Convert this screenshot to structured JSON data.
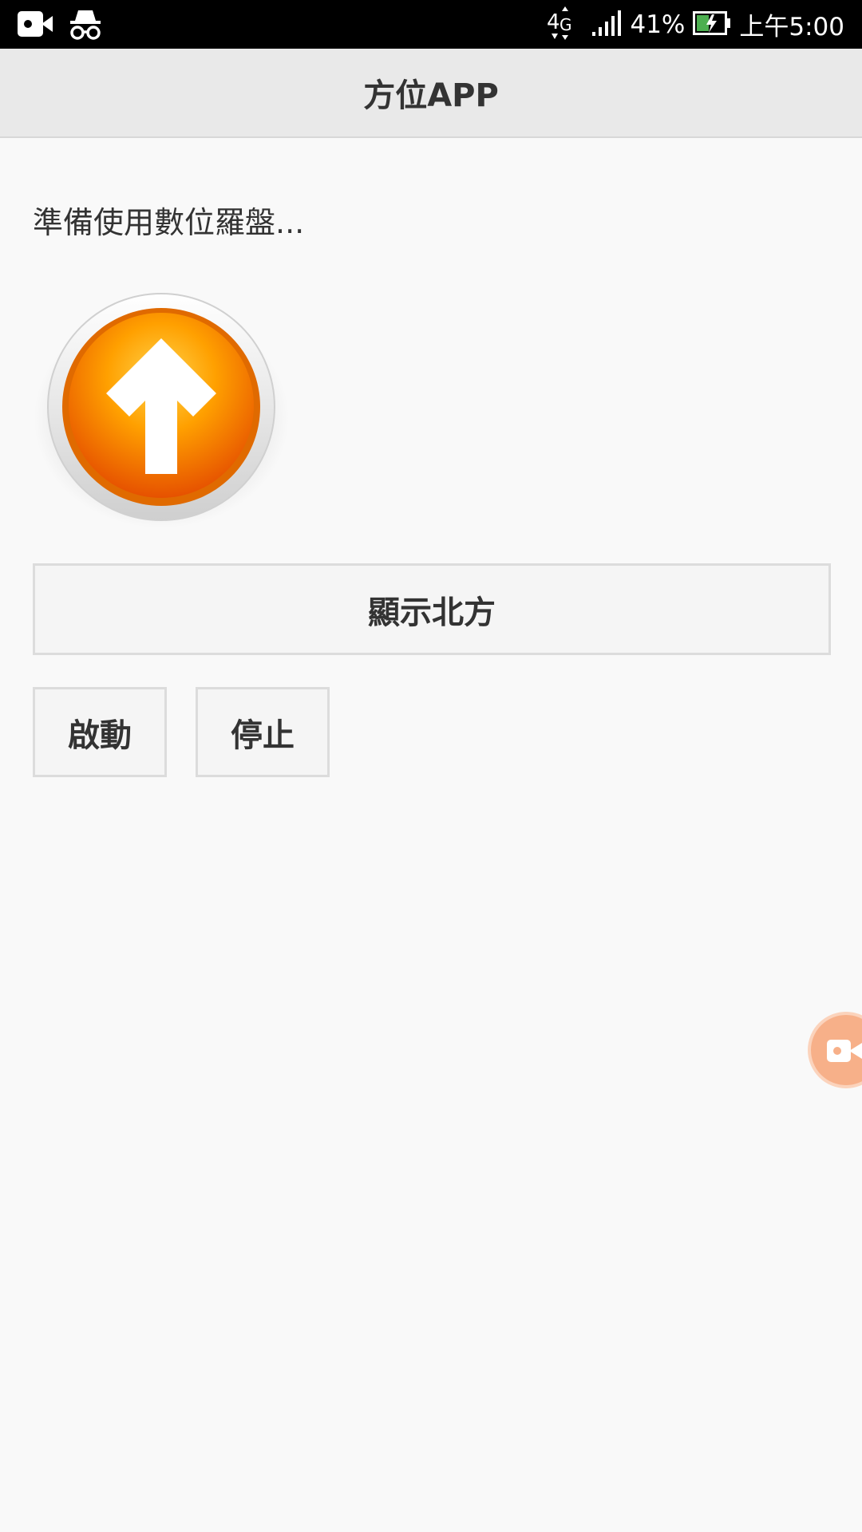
{
  "status_bar": {
    "network": "4G",
    "battery_percent": "41%",
    "time": "上午5:00",
    "left_icons": [
      "video-camera-icon",
      "incognito-icon"
    ],
    "right_icons": [
      "network-4g-icon",
      "signal-icon",
      "battery-charging-icon"
    ]
  },
  "header": {
    "title": "方位APP"
  },
  "main": {
    "status_message": "準備使用數位羅盤...",
    "compass_icon": "north-arrow-compass-icon",
    "show_north_label": "顯示北方",
    "start_label": "啟動",
    "stop_label": "停止"
  },
  "overlay": {
    "floating_button_icon": "screen-recorder-icon"
  },
  "colors": {
    "status_bar_bg": "#000000",
    "action_bar_bg": "#e9e9e9",
    "page_bg": "#f9f9f9",
    "compass_orange": "#f57c00",
    "compass_yellow": "#ffc107",
    "recorder_bubble": "#f7b089"
  }
}
